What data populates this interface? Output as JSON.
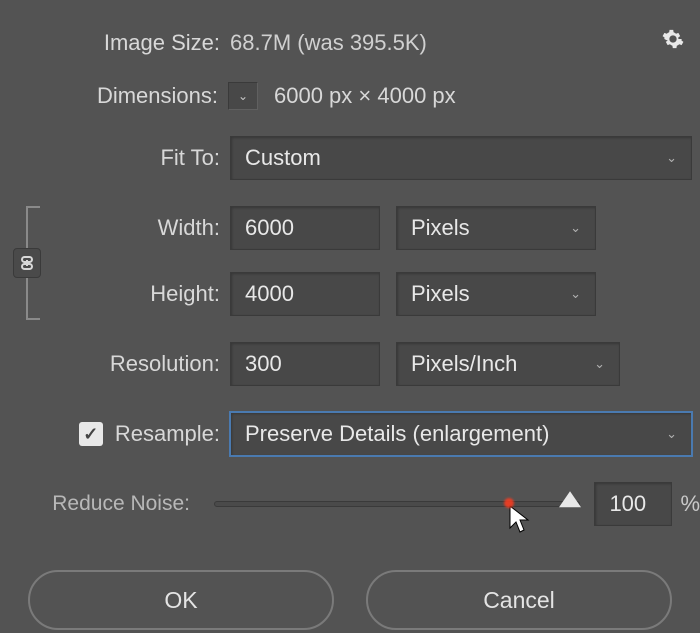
{
  "header": {
    "image_size_label": "Image Size:",
    "image_size_value": "68.7M (was 395.5K)",
    "gear_icon": "gear"
  },
  "dimensions": {
    "label": "Dimensions:",
    "text": "6000 px  ×  4000 px"
  },
  "fit_to": {
    "label": "Fit To:",
    "value": "Custom"
  },
  "width": {
    "label": "Width:",
    "value": "6000",
    "unit": "Pixels"
  },
  "height": {
    "label": "Height:",
    "value": "4000",
    "unit": "Pixels"
  },
  "resolution": {
    "label": "Resolution:",
    "value": "300",
    "unit": "Pixels/Inch"
  },
  "resample": {
    "label": "Resample:",
    "checked": true,
    "value": "Preserve Details (enlargement)"
  },
  "noise": {
    "label": "Reduce Noise:",
    "value": "100",
    "percent": "%"
  },
  "buttons": {
    "ok": "OK",
    "cancel": "Cancel"
  }
}
